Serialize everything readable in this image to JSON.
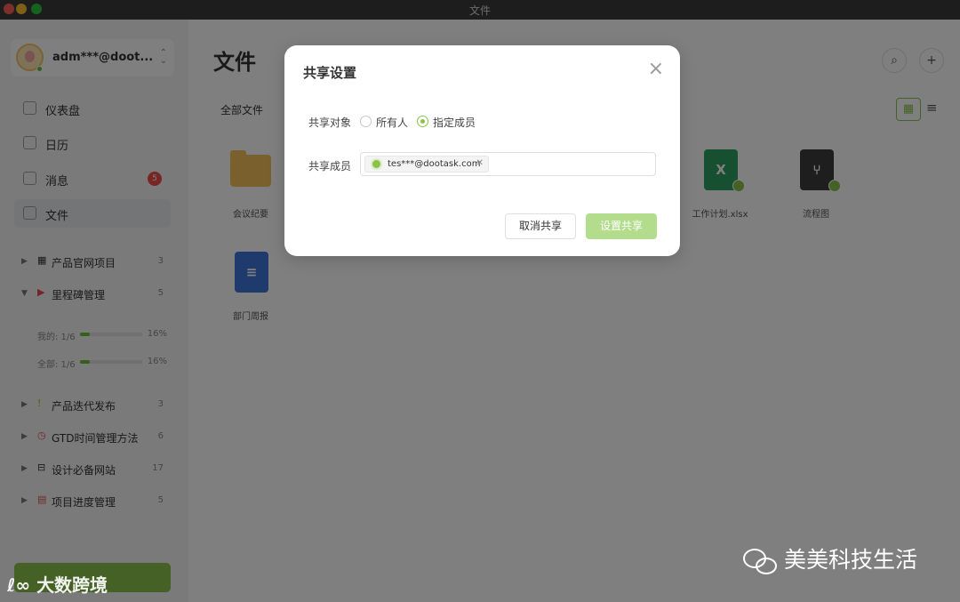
{
  "window": {
    "title": "文件"
  },
  "account": {
    "name": "adm***@doot..."
  },
  "sidebar": {
    "nav": [
      {
        "label": "仪表盘",
        "icon": "dashboard-icon"
      },
      {
        "label": "日历",
        "icon": "calendar-icon"
      },
      {
        "label": "消息",
        "icon": "message-icon",
        "badge": "5"
      },
      {
        "label": "文件",
        "icon": "file-icon",
        "active": true
      }
    ],
    "projects": [
      {
        "name": "产品官网项目",
        "count": "3",
        "icon": "building-icon"
      },
      {
        "name": "里程碑管理",
        "count": "5",
        "icon": "flag-icon",
        "expanded": true
      },
      {
        "name": "产品迭代发布",
        "count": "3",
        "icon": "bulb-icon"
      },
      {
        "name": "GTD时间管理方法",
        "count": "6",
        "icon": "alarm-clock-icon"
      },
      {
        "name": "设计必备网站",
        "count": "17",
        "icon": "basket-icon"
      },
      {
        "name": "项目进度管理",
        "count": "5",
        "icon": "calendar-icon"
      }
    ],
    "progress": [
      {
        "label": "我的: 1/6",
        "value": "16%",
        "fraction": 0.16
      },
      {
        "label": "全部: 1/6",
        "value": "16%",
        "fraction": 0.16
      }
    ]
  },
  "main": {
    "title": "文件",
    "breadcrumb": "全部文件",
    "files": [
      {
        "name": "会议纪要",
        "type": "folder"
      },
      {
        "name": "工作计划.xlsx",
        "type": "excel",
        "badge": "X"
      },
      {
        "name": "流程图",
        "type": "flowchart"
      },
      {
        "name": "部门周报",
        "type": "word"
      }
    ]
  },
  "dialog": {
    "title": "共享设置",
    "target_label": "共享对象",
    "option_everyone": "所有人",
    "option_members": "指定成员",
    "members_label": "共享成员",
    "member_tag": "tes***@dootask.com",
    "cancel_label": "取消共享",
    "confirm_label": "设置共享"
  },
  "watermarks": {
    "left": "大数跨境",
    "right": "美美科技生活"
  },
  "colors": {
    "accent": "#8bc34a",
    "badge": "#f04b4b"
  }
}
